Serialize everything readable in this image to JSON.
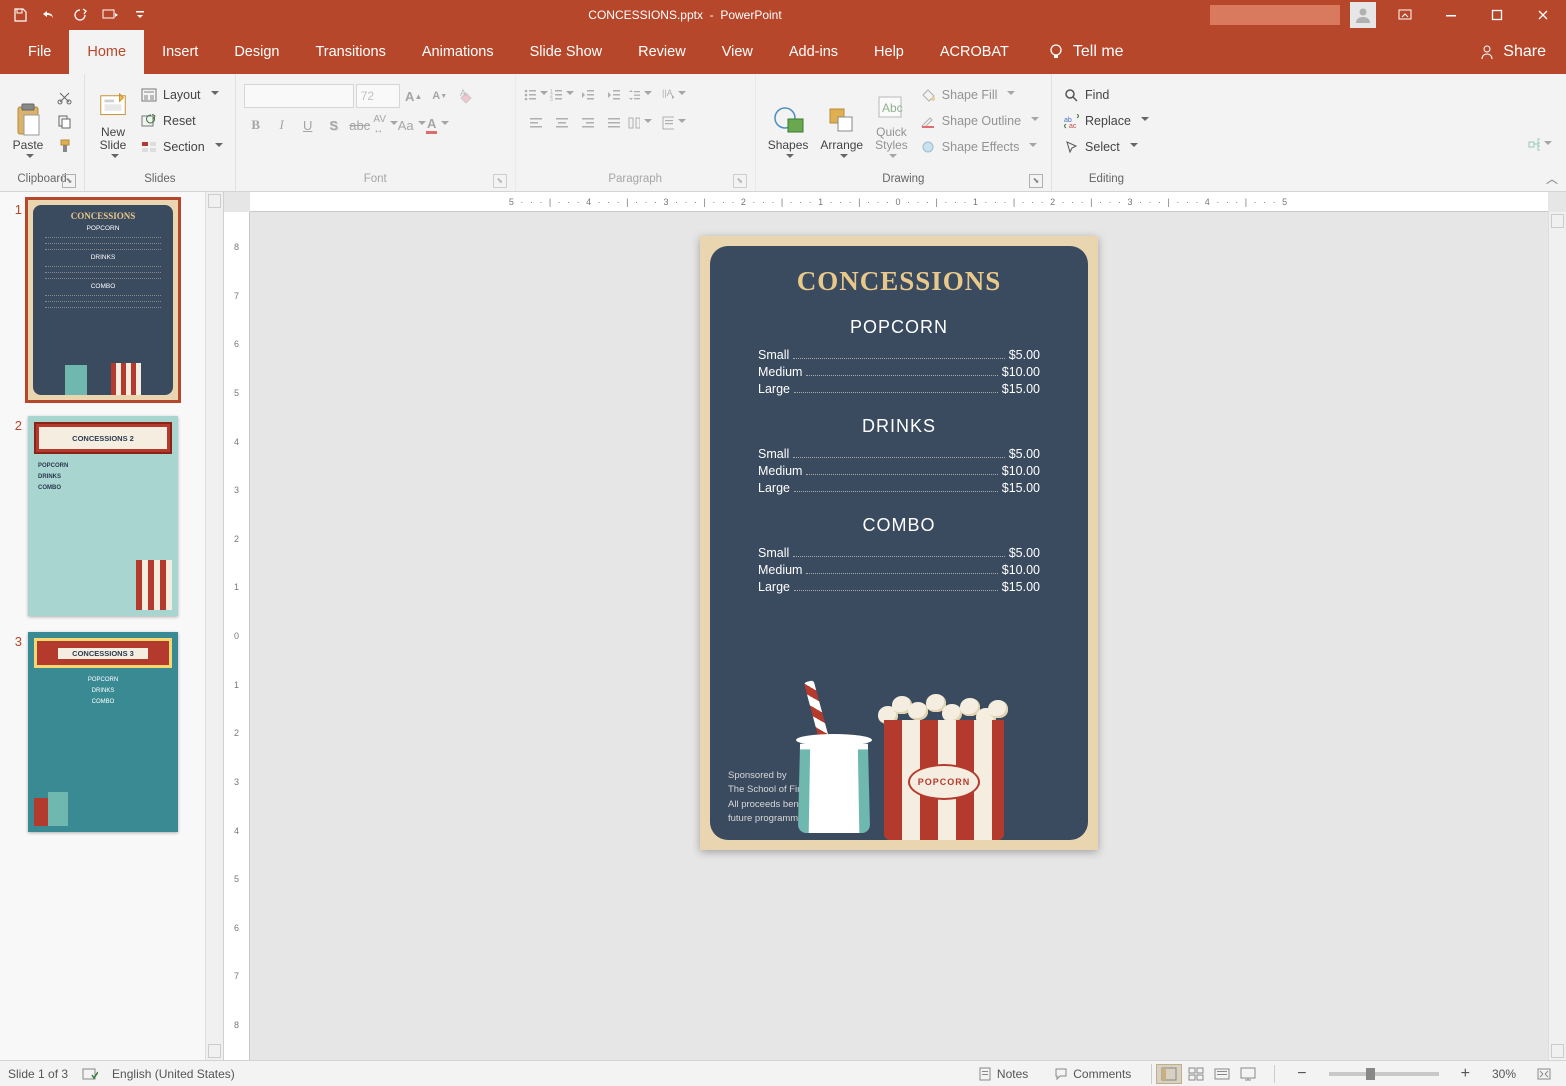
{
  "titlebar": {
    "filename": "CONCESSIONS.pptx",
    "appname": "PowerPoint"
  },
  "tabs": {
    "file": "File",
    "home": "Home",
    "insert": "Insert",
    "design": "Design",
    "transitions": "Transitions",
    "animations": "Animations",
    "slideshow": "Slide Show",
    "review": "Review",
    "view": "View",
    "addins": "Add-ins",
    "help": "Help",
    "acrobat": "ACROBAT",
    "tellme": "Tell me",
    "share": "Share"
  },
  "ribbon": {
    "clipboard": {
      "label": "Clipboard",
      "paste": "Paste"
    },
    "slides": {
      "label": "Slides",
      "newslide": "New\nSlide",
      "layout": "Layout",
      "reset": "Reset",
      "section": "Section"
    },
    "font": {
      "label": "Font",
      "size": "72"
    },
    "paragraph": {
      "label": "Paragraph"
    },
    "drawing": {
      "label": "Drawing",
      "shapes": "Shapes",
      "arrange": "Arrange",
      "quick": "Quick\nStyles",
      "fill": "Shape Fill",
      "outline": "Shape Outline",
      "effects": "Shape Effects"
    },
    "editing": {
      "label": "Editing",
      "find": "Find",
      "replace": "Replace",
      "select": "Select"
    }
  },
  "statusbar": {
    "slide": "Slide 1 of 3",
    "lang": "English (United States)",
    "notes": "Notes",
    "comments": "Comments",
    "zoom": "30%"
  },
  "thumbs": [
    {
      "num": "1",
      "title": "CONCESSIONS"
    },
    {
      "num": "2",
      "title": "CONCESSIONS 2"
    },
    {
      "num": "3",
      "title": "CONCESSIONS 3"
    }
  ],
  "slide": {
    "title": "CONCESSIONS",
    "sections": [
      {
        "name": "POPCORN",
        "items": [
          {
            "label": "Small",
            "price": "$5.00"
          },
          {
            "label": "Medium",
            "price": "$10.00"
          },
          {
            "label": "Large",
            "price": "$15.00"
          }
        ]
      },
      {
        "name": "DRINKS",
        "items": [
          {
            "label": "Small",
            "price": "$5.00"
          },
          {
            "label": "Medium",
            "price": "$10.00"
          },
          {
            "label": "Large",
            "price": "$15.00"
          }
        ]
      },
      {
        "name": "COMBO",
        "items": [
          {
            "label": "Small",
            "price": "$5.00"
          },
          {
            "label": "Medium",
            "price": "$10.00"
          },
          {
            "label": "Large",
            "price": "$15.00"
          }
        ]
      }
    ],
    "sponsor": [
      "Sponsored by",
      "The School of Fine Arts",
      "All proceeds benefit",
      "future programming"
    ],
    "popcorn_label": "POPCORN"
  },
  "thumb_sections": [
    "POPCORN",
    "DRINKS",
    "COMBO"
  ],
  "ruler_h": "5 · · · | · · · 4 · · · | · · · 3 · · · | · · · 2 · · · | · · · 1 · · · | · · · 0 · · · | · · · 1 · · · | · · · 2 · · · | · · · 3 · · · | · · · 4 · · · | · · · 5",
  "ruler_v": [
    "8",
    "7",
    "6",
    "5",
    "4",
    "3",
    "2",
    "1",
    "0",
    "1",
    "2",
    "3",
    "4",
    "5",
    "6",
    "7",
    "8"
  ]
}
